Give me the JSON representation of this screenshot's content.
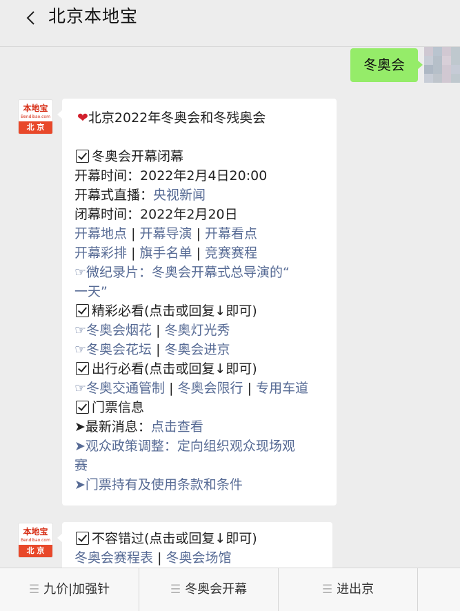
{
  "header": {
    "title": "北京本地宝"
  },
  "user_message": {
    "text": "冬奥会"
  },
  "bot": {
    "avatar_logo": "本地宝",
    "avatar_logo_sub": "Bendibao.com",
    "avatar_city": "北 京"
  },
  "message1": {
    "title": "北京2022年冬奥会和冬残奥会",
    "section1": "冬奥会开幕闭幕",
    "open_time_label": "开幕时间：",
    "open_time": "2022年2月4日20:00",
    "live_label": "开幕式直播：",
    "live_link": "央视新闻",
    "close_time_label": "闭幕时间：",
    "close_time": "2022年2月20日",
    "links_row1": [
      "开幕地点",
      "开幕导演",
      "开幕看点"
    ],
    "links_row2": [
      "开幕彩排",
      "旗手名单",
      "竞赛赛程"
    ],
    "doc_line1": "☞微纪录片：冬奥会开幕式总导演的“",
    "doc_line2": "一天”",
    "section2": "精彩必看(点击或回复↓即可)",
    "fireworks": "☞冬奥会烟花",
    "lights": "冬奥灯光秀",
    "flowers": "☞冬奥会花坛",
    "enter_city": "冬奥会进京",
    "section3": "出行必看(点击或回复↓即可)",
    "traffic": "☞冬奥交通管制",
    "restriction": "冬奥会限行",
    "lane": "专用车道",
    "section4": "门票信息",
    "news_label": "➤最新消息：",
    "news_link": "点击查看",
    "policy_line1": "➤观众政策调整：定向组织观众现场观",
    "policy_line2": "赛",
    "terms": "➤门票持有及使用条款和条件"
  },
  "message2": {
    "section": "不容错过(点击或回复↓即可)",
    "schedule": "冬奥会赛程表",
    "venues": "冬奥会场馆"
  },
  "bottom_menu": [
    "九价|加强针",
    "冬奥会开幕",
    "进出京",
    ""
  ]
}
